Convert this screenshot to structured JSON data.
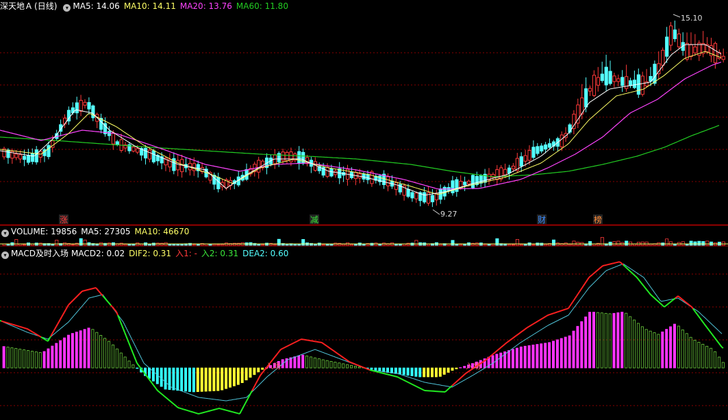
{
  "price_panel": {
    "stock_name": "深天地Ａ",
    "period": "(日线)",
    "ma5": "MA5: 14.06",
    "ma10": "MA10: 14.11",
    "ma20": "MA20: 13.76",
    "ma60": "MA60: 11.80",
    "high_label": "15.10",
    "low_label": "9.27",
    "markers": [
      {
        "text": "涨",
        "color": "#ff3a3a"
      },
      {
        "text": "减",
        "color": "#3ae63a"
      },
      {
        "text": "财",
        "color": "#3a8cff"
      },
      {
        "text": "榜",
        "color": "#ff8c3a"
      }
    ]
  },
  "volume_panel": {
    "title": "VOLUME: 19856",
    "ma5": "MA5: 27305",
    "ma10": "MA10: 46670"
  },
  "macd_panel": {
    "title": "MACD及时入场",
    "macd2": "MACD2: 0.02",
    "dif2": "DIF2: 0.31",
    "in1": "入1: -",
    "in2": "入2: 0.31",
    "dea2": "DEA2: 0.60",
    "entry_label": "入场"
  },
  "colors": {
    "up": "#ff3a3a",
    "down": "#54ffff",
    "ma5": "#ffffff",
    "ma10": "#ffff66",
    "ma20": "#ff44ff",
    "ma60": "#22cc22",
    "grid": "#8a0000"
  }
}
